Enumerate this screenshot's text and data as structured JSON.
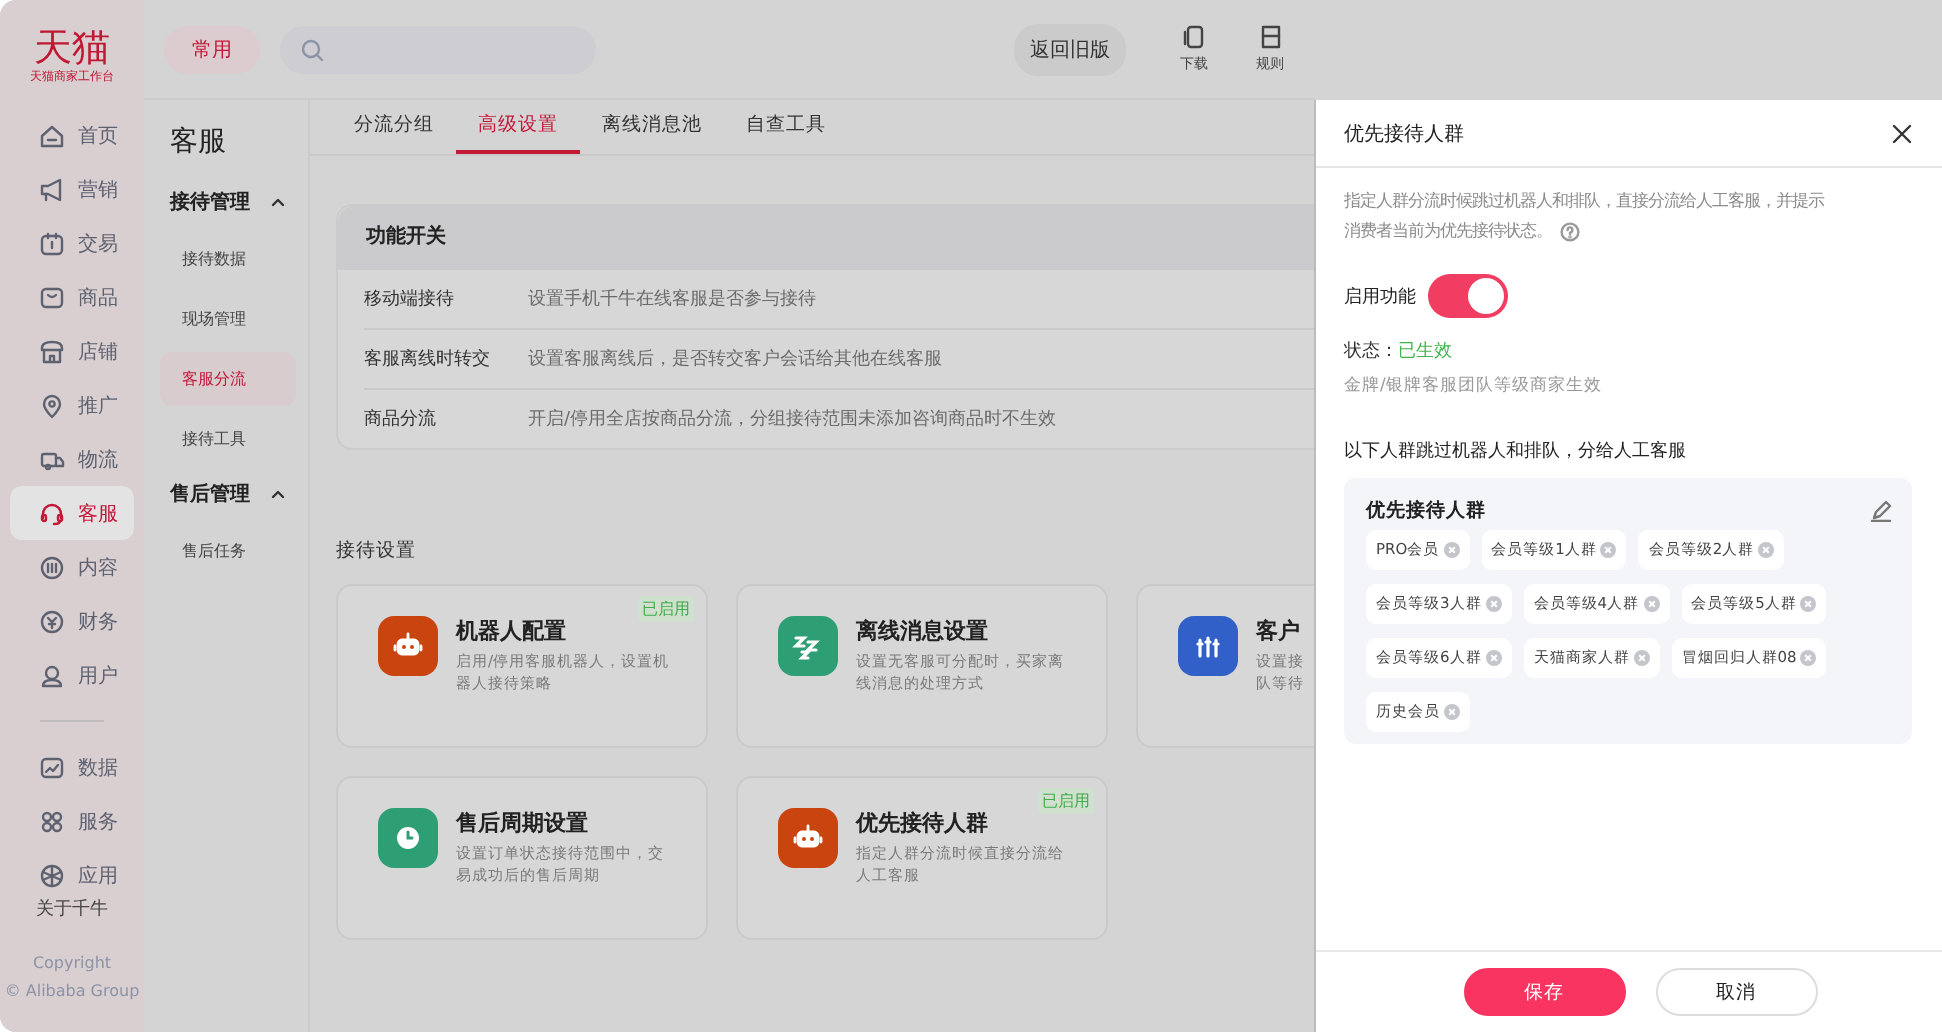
{
  "logo": {
    "name": "天猫",
    "subtitle": "天猫商家工作台"
  },
  "topbar": {
    "common_button": "常用",
    "back_button": "返回旧版",
    "tools": [
      {
        "label": "下载"
      },
      {
        "label": "规则"
      }
    ]
  },
  "nav": {
    "items": [
      {
        "label": "首页",
        "selected": false
      },
      {
        "label": "营销",
        "selected": false
      },
      {
        "label": "交易",
        "selected": false
      },
      {
        "label": "商品",
        "selected": false
      },
      {
        "label": "店铺",
        "selected": false
      },
      {
        "label": "推广",
        "selected": false
      },
      {
        "label": "物流",
        "selected": false
      },
      {
        "label": "客服",
        "selected": true
      },
      {
        "label": "内容",
        "selected": false
      },
      {
        "label": "财务",
        "selected": false
      },
      {
        "label": "用户",
        "selected": false
      }
    ],
    "lower_items": [
      {
        "label": "数据",
        "selected": false
      },
      {
        "label": "服务",
        "selected": false
      },
      {
        "label": "应用",
        "selected": false
      }
    ],
    "about": "关于千牛",
    "copyright": [
      "Copyright",
      "© Alibaba Group"
    ]
  },
  "submenu": {
    "title": "客服",
    "groups": [
      {
        "label": "接待管理",
        "expanded": true,
        "items": [
          {
            "label": "接待数据",
            "selected": false
          },
          {
            "label": "现场管理",
            "selected": false
          },
          {
            "label": "客服分流",
            "selected": true
          },
          {
            "label": "接待工具",
            "selected": false
          }
        ]
      },
      {
        "label": "售后管理",
        "expanded": true,
        "items": [
          {
            "label": "售后任务",
            "selected": false
          }
        ]
      }
    ]
  },
  "tabs": [
    {
      "label": "分流分组",
      "selected": false
    },
    {
      "label": "高级设置",
      "selected": true
    },
    {
      "label": "离线消息池",
      "selected": false
    },
    {
      "label": "自查工具",
      "selected": false
    }
  ],
  "switches": {
    "title": "功能开关",
    "rows": [
      {
        "label": "移动端接待",
        "description": "设置手机千牛在线客服是否参与接待"
      },
      {
        "label": "客服离线时转交",
        "description": "设置客服离线后，是否转交客户会话给其他在线客服"
      },
      {
        "label": "商品分流",
        "description": "开启/停用全店按商品分流，分组接待范围未添加咨询商品时不生效"
      }
    ]
  },
  "reception": {
    "title": "接待设置",
    "cards": [
      {
        "title": "机器人配置",
        "description": [
          "启用/停用客服机器人，设置机",
          "器人接待策略"
        ],
        "badge": "已启用",
        "color": "#c9440f"
      },
      {
        "title": "离线消息设置",
        "description": [
          "设置无客服可分配时，买家离",
          "线消息的处理方式"
        ],
        "color": "#2e9e74"
      },
      {
        "title": "客户",
        "description": [
          "设置接",
          "队等待"
        ],
        "color": "#3060c8"
      },
      {
        "title": "售后周期设置",
        "description": [
          "设置订单状态接待范围中，交",
          "易成功后的售后周期"
        ],
        "color": "#2e9e74"
      },
      {
        "title": "优先接待人群",
        "description": [
          "指定人群分流时候直接分流给",
          "人工客服"
        ],
        "badge": "已启用",
        "color": "#c9440f"
      }
    ]
  },
  "drawer": {
    "title": "优先接待人群",
    "description": [
      "指定人群分流时候跳过机器人和排队，直接分流给人工客服，并提示",
      "消费者当前为优先接待状态。"
    ],
    "toggle": {
      "label": "启用功能",
      "on": true
    },
    "status": {
      "label": "状态：",
      "value": "已生效"
    },
    "note": "金牌/银牌客服团队等级商家生效",
    "section_title": "以下人群跳过机器人和排队，分给人工客服",
    "group": {
      "title": "优先接待人群",
      "tags": [
        "PRO会员",
        "会员等级1人群",
        "会员等级2人群",
        "会员等级3人群",
        "会员等级4人群",
        "会员等级5人群",
        "会员等级6人群",
        "天猫商家人群",
        "冒烟回归人群08",
        "历史会员"
      ]
    },
    "buttons": [
      {
        "label": "保存",
        "kind": "primary"
      },
      {
        "label": "取消",
        "kind": "default"
      }
    ]
  }
}
